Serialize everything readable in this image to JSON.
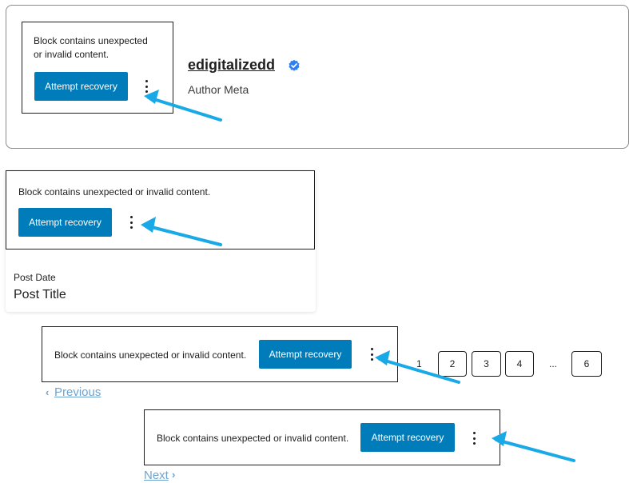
{
  "blocks": {
    "warning_message_wrapped": "Block contains unexpected\nor invalid content.",
    "warning_message": "Block contains unexpected or invalid content.",
    "recovery_button_label": "Attempt recovery"
  },
  "author": {
    "name": "edigitalizedd",
    "meta": "Author Meta",
    "verified_icon": "verified-badge-icon"
  },
  "post": {
    "date_label": "Post Date",
    "title_label": "Post Title"
  },
  "pagination": {
    "previous_label": "Previous",
    "next_label": "Next",
    "pages": [
      "1",
      "2",
      "3",
      "4",
      "...",
      "6"
    ]
  },
  "colors": {
    "button": "#007cba",
    "annotation_arrow": "#18a9e6",
    "verified_badge": "#2f80ed",
    "link": "#6fa3cf"
  }
}
